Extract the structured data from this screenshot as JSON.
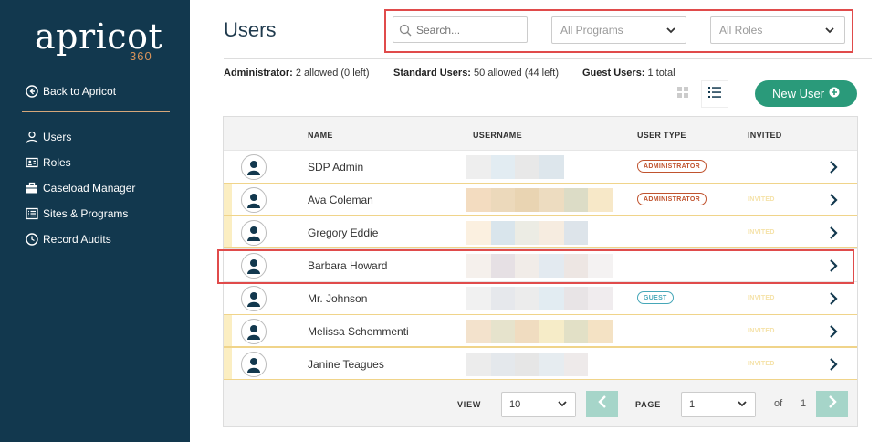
{
  "sidebar": {
    "logo": "apricot",
    "logo_sub": "360",
    "back_label": "Back to Apricot",
    "items": [
      {
        "label": "Users",
        "icon": "user-icon"
      },
      {
        "label": "Roles",
        "icon": "id-card-icon"
      },
      {
        "label": "Caseload Manager",
        "icon": "briefcase-icon"
      },
      {
        "label": "Sites & Programs",
        "icon": "list-icon"
      },
      {
        "label": "Record Audits",
        "icon": "clock-icon"
      }
    ]
  },
  "header": {
    "title": "Users",
    "search_placeholder": "Search...",
    "programs_filter": "All Programs",
    "roles_filter": "All Roles",
    "new_user_label": "New User"
  },
  "allocation": {
    "admin_label": "Administrator:",
    "admin_value": "2 allowed (0 left)",
    "standard_label": "Standard Users:",
    "standard_value": "50 allowed (44 left)",
    "guest_label": "Guest Users:",
    "guest_value": "1 total"
  },
  "table": {
    "columns": [
      "NAME",
      "USERNAME",
      "USER TYPE",
      "INVITED"
    ],
    "rows": [
      {
        "name": "SDP Admin",
        "type": "ADMINISTRATOR",
        "invited": ""
      },
      {
        "name": "Ava Coleman",
        "type": "ADMINISTRATOR",
        "invited": "INVITED"
      },
      {
        "name": "Gregory Eddie",
        "type": "",
        "invited": "INVITED"
      },
      {
        "name": "Barbara Howard",
        "type": "",
        "invited": ""
      },
      {
        "name": "Mr. Johnson",
        "type": "GUEST",
        "invited": "INVITED"
      },
      {
        "name": "Melissa Schemmenti",
        "type": "",
        "invited": "INVITED"
      },
      {
        "name": "Janine Teagues",
        "type": "",
        "invited": "INVITED"
      }
    ]
  },
  "pagination": {
    "view_label": "VIEW",
    "view_value": "10",
    "page_label": "PAGE",
    "page_value": "1",
    "of_label": "of",
    "total_pages": "1"
  },
  "colors": {
    "sidebar_bg": "#12384e",
    "accent_green": "#2a9a7a",
    "admin_badge": "#c0532e",
    "guest_badge": "#46a7b8",
    "highlight": "#e04b4b"
  }
}
